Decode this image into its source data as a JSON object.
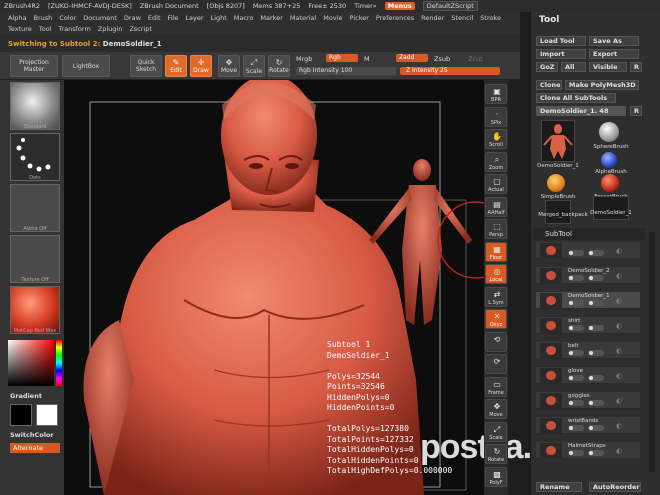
{
  "titlebar": {
    "app": "ZBrush4R2",
    "host": "[ZUKO-IHMCF-AVDJ-DESK]",
    "doc": "ZBrush Document",
    "objs": "[Objs 8207]",
    "mem": "Mems 387+25",
    "free": "Free± 2530",
    "timer": "Timer»",
    "menus_label": "Menus",
    "script_label": "DefaultZScript"
  },
  "menubar": {
    "row1": [
      "Alpha",
      "Brush",
      "Color",
      "Document",
      "Draw",
      "Edit",
      "File",
      "Layer",
      "Light",
      "Macro",
      "Marker",
      "Material",
      "Movie",
      "Picker",
      "Preferences",
      "Render",
      "Stencil",
      "Stroke"
    ],
    "row2": [
      "Texture",
      "Tool",
      "Transform",
      "Zplugin",
      "Zscript"
    ]
  },
  "subtool_line": {
    "prefix": "Switching to Subtool 2:",
    "name": "DemoSoldier_1"
  },
  "toolbar": {
    "projection_master": "Projection Master",
    "lightbox": "LightBox",
    "quick_sketch": "Quick Sketch",
    "edit": "Edit",
    "draw": "Draw",
    "move": "Move",
    "scale": "Scale",
    "rotate": "Rotate",
    "mrgb": "Mrgb",
    "rgb": "Rgb",
    "m": "M",
    "zadd": "Zadd",
    "zsub": "Zsub",
    "zcut": "Zcut",
    "rgb_intensity": "Rgb Intensity 100",
    "z_intensity": "Z Intensity 25"
  },
  "left": {
    "brushes": [
      "Standard",
      "Dots",
      "Alpha Off",
      "Texture Off",
      "MatCap Red Wax"
    ],
    "gradient": "Gradient",
    "switch_color": "SwitchColor",
    "alternate": "Alternate"
  },
  "vtools": [
    {
      "label": "BPR",
      "icon": "▣"
    },
    {
      "label": "SPix",
      "icon": "·"
    },
    {
      "label": "Scroll",
      "icon": "✋"
    },
    {
      "label": "Zoom",
      "icon": "⌕"
    },
    {
      "label": "Actual",
      "icon": "▢"
    },
    {
      "label": "AAHalf",
      "icon": "▤"
    },
    {
      "label": "Persp",
      "icon": "⬚"
    },
    {
      "label": "Floor",
      "icon": "▦"
    },
    {
      "label": "Local",
      "icon": "◎"
    },
    {
      "label": "L.Sym",
      "icon": "⇄"
    },
    {
      "label": "Qxyz",
      "icon": "✕"
    },
    {
      "label": "",
      "icon": "⟲"
    },
    {
      "label": "",
      "icon": "⟳"
    },
    {
      "label": "Frame",
      "icon": "▭"
    },
    {
      "label": "Move",
      "icon": "✥"
    },
    {
      "label": "Scale",
      "icon": "⤢"
    },
    {
      "label": "Rotate",
      "icon": "↻"
    },
    {
      "label": "PolyF",
      "icon": "▩"
    }
  ],
  "right": {
    "title": "Tool",
    "load_tool": "Load Tool",
    "save_as": "Save As",
    "import": "Import",
    "export": "Export",
    "goz": "GoZ",
    "all": "All",
    "visible": "Visible",
    "r": "R",
    "clone": "Clone",
    "make_polymesh": "Make PolyMesh3D",
    "clone_all": "Clone All SubTools",
    "current_tool": "DemoSoldier_1. 48",
    "r2": "R",
    "tools": [
      "DemoSoldier_1",
      "SphereBrush",
      "AlphaBrush",
      "SimpleBrush",
      "EraserBrush",
      "Merged_backpack",
      "DemoSoldier_1"
    ],
    "subtool_header": "SubTool",
    "subtools": [
      "",
      "DemoSoldier_2",
      "DemoSoldier_1",
      "shirt",
      "belt",
      "glove",
      "goggles",
      "wristBands",
      "HalmetStraps"
    ],
    "rename": "Rename",
    "auto_reorder": "AutoReorder"
  },
  "info": {
    "lines": [
      "Subtool 1",
      "DemoSoldier_1",
      "",
      "Polys=32544",
      "Points=32546",
      "HiddenPolys=0",
      "HiddenPoints=0",
      "",
      "TotalPolys=127380",
      "TotalPoints=127332",
      "TotalHiddenPolys=0",
      "TotalHiddenPoints=0",
      "TotalHighDefPolys=0.000000"
    ]
  },
  "watermark": "postila.ru",
  "colors": {
    "accent": "#e06a2a",
    "skin": "#d9604a"
  }
}
